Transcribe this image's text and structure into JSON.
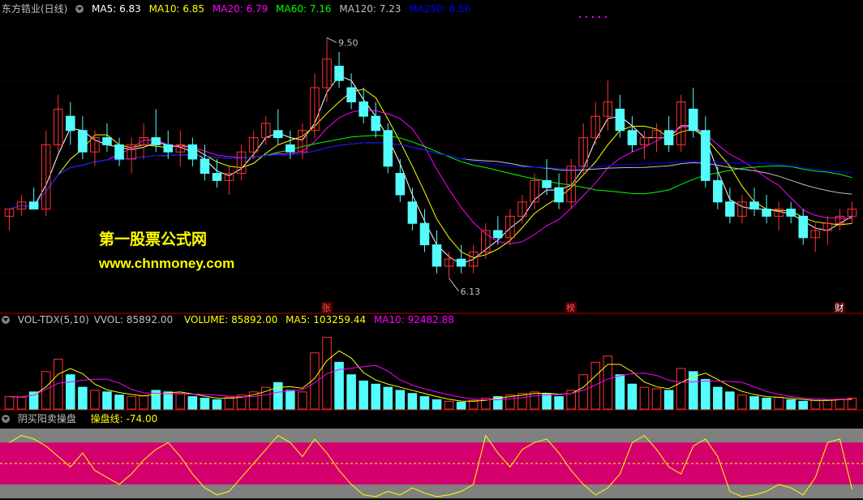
{
  "main_header": {
    "title": "东方锆业(日线)",
    "ma": [
      {
        "label": "MA5: 6.83",
        "color": "#ffffff"
      },
      {
        "label": "MA10: 6.85",
        "color": "#ffff00"
      },
      {
        "label": "MA20: 6.79",
        "color": "#ff00ff"
      },
      {
        "label": "MA60: 7.16",
        "color": "#00ff00"
      },
      {
        "label": "MA120: 7.23",
        "color": "#c0c0c0"
      },
      {
        "label": "MA250: 8.56",
        "color": "#0000ff"
      }
    ]
  },
  "annotations": {
    "high": "9.50",
    "low": "6.13"
  },
  "markers": [
    "张",
    "榜",
    "财"
  ],
  "watermark": {
    "line1": "第一股票公式网",
    "line2": "www.chnmoney.com"
  },
  "vol_header": {
    "name": "VOL-TDX(5,10)",
    "vvol": "VVOL: 85892.00",
    "volume": "VOLUME: 85892.00",
    "ma5": "MA5: 103259.44",
    "ma10": "MA10: 92482.88"
  },
  "ind_header": {
    "name": "阴买阳卖操盘",
    "line": "操盘线: -74.00"
  },
  "colors": {
    "up": "#ff3232",
    "down": "#54fcfc",
    "band": "#d4006e",
    "panel_gray": "#808080"
  },
  "chart_data": [
    {
      "type": "candlestick",
      "title": "东方锆业(日线)",
      "ohlc": [
        [
          7.0,
          7.1,
          6.8,
          7.1
        ],
        [
          7.1,
          7.3,
          7.0,
          7.2
        ],
        [
          7.2,
          7.4,
          7.1,
          7.1
        ],
        [
          7.1,
          8.2,
          7.0,
          8.0
        ],
        [
          8.0,
          8.7,
          7.9,
          8.5
        ],
        [
          8.4,
          8.6,
          8.0,
          8.2
        ],
        [
          8.2,
          8.4,
          7.8,
          7.9
        ],
        [
          7.9,
          8.2,
          7.7,
          8.1
        ],
        [
          8.1,
          8.3,
          7.9,
          8.0
        ],
        [
          8.0,
          8.1,
          7.7,
          7.8
        ],
        [
          7.8,
          8.1,
          7.6,
          8.0
        ],
        [
          8.0,
          8.3,
          7.8,
          8.1
        ],
        [
          8.1,
          8.5,
          7.9,
          8.0
        ],
        [
          8.0,
          8.2,
          7.8,
          7.9
        ],
        [
          7.9,
          8.2,
          7.7,
          8.0
        ],
        [
          8.0,
          8.1,
          7.7,
          7.8
        ],
        [
          7.8,
          8.0,
          7.5,
          7.6
        ],
        [
          7.6,
          7.8,
          7.4,
          7.5
        ],
        [
          7.5,
          7.7,
          7.3,
          7.6
        ],
        [
          7.6,
          8.0,
          7.5,
          7.9
        ],
        [
          7.9,
          8.2,
          7.8,
          8.1
        ],
        [
          8.1,
          8.4,
          8.0,
          8.3
        ],
        [
          8.2,
          8.5,
          8.0,
          8.1
        ],
        [
          8.0,
          8.2,
          7.8,
          7.9
        ],
        [
          7.9,
          8.3,
          7.8,
          8.2
        ],
        [
          8.2,
          9.0,
          8.1,
          8.8
        ],
        [
          8.8,
          9.5,
          8.6,
          9.2
        ],
        [
          9.1,
          9.3,
          8.8,
          8.9
        ],
        [
          8.8,
          9.0,
          8.5,
          8.6
        ],
        [
          8.6,
          8.8,
          8.3,
          8.4
        ],
        [
          8.4,
          8.6,
          8.1,
          8.2
        ],
        [
          8.2,
          8.3,
          7.6,
          7.7
        ],
        [
          7.6,
          7.8,
          7.2,
          7.3
        ],
        [
          7.2,
          7.4,
          6.8,
          6.9
        ],
        [
          6.9,
          7.1,
          6.5,
          6.6
        ],
        [
          6.6,
          6.8,
          6.2,
          6.3
        ],
        [
          6.3,
          6.5,
          6.13,
          6.4
        ],
        [
          6.4,
          6.6,
          6.2,
          6.3
        ],
        [
          6.3,
          6.6,
          6.2,
          6.5
        ],
        [
          6.5,
          6.9,
          6.4,
          6.8
        ],
        [
          6.8,
          7.0,
          6.6,
          6.7
        ],
        [
          6.7,
          7.1,
          6.6,
          7.0
        ],
        [
          7.0,
          7.3,
          6.9,
          7.2
        ],
        [
          7.2,
          7.6,
          7.1,
          7.5
        ],
        [
          7.5,
          7.8,
          7.3,
          7.4
        ],
        [
          7.4,
          7.6,
          7.1,
          7.2
        ],
        [
          7.2,
          7.8,
          7.1,
          7.7
        ],
        [
          7.7,
          8.3,
          7.6,
          8.1
        ],
        [
          8.1,
          8.6,
          8.0,
          8.4
        ],
        [
          8.4,
          8.9,
          8.2,
          8.6
        ],
        [
          8.5,
          8.7,
          8.1,
          8.2
        ],
        [
          8.2,
          8.4,
          7.9,
          8.0
        ],
        [
          8.0,
          8.2,
          7.8,
          8.1
        ],
        [
          8.1,
          8.3,
          7.9,
          8.2
        ],
        [
          8.2,
          8.4,
          7.9,
          8.0
        ],
        [
          8.0,
          8.7,
          7.9,
          8.6
        ],
        [
          8.5,
          8.8,
          8.1,
          8.2
        ],
        [
          8.2,
          8.4,
          7.4,
          7.5
        ],
        [
          7.5,
          7.7,
          7.1,
          7.2
        ],
        [
          7.2,
          7.4,
          6.9,
          7.0
        ],
        [
          7.0,
          7.3,
          6.9,
          7.2
        ],
        [
          7.2,
          7.4,
          7.0,
          7.1
        ],
        [
          7.1,
          7.3,
          6.9,
          7.0
        ],
        [
          7.0,
          7.2,
          6.8,
          7.1
        ],
        [
          7.1,
          7.2,
          6.9,
          7.0
        ],
        [
          7.0,
          7.1,
          6.6,
          6.7
        ],
        [
          6.7,
          6.9,
          6.5,
          6.8
        ],
        [
          6.8,
          7.0,
          6.6,
          6.9
        ],
        [
          6.9,
          7.1,
          6.8,
          7.0
        ],
        [
          7.0,
          7.2,
          6.9,
          7.1
        ]
      ],
      "ma_series": [
        {
          "name": "MA5",
          "color": "#ffffff"
        },
        {
          "name": "MA10",
          "color": "#ffff00"
        },
        {
          "name": "MA20",
          "color": "#ff00ff"
        },
        {
          "name": "MA60",
          "color": "#00ff00"
        },
        {
          "name": "MA120",
          "color": "#c0c0c0"
        },
        {
          "name": "MA250",
          "color": "#0000ff"
        }
      ],
      "ylim": [
        5.8,
        9.8
      ]
    },
    {
      "type": "bar",
      "title": "VOL-TDX(5,10)",
      "values": [
        40,
        38,
        55,
        120,
        160,
        110,
        70,
        60,
        55,
        45,
        40,
        42,
        60,
        55,
        50,
        40,
        35,
        30,
        38,
        45,
        55,
        70,
        85,
        60,
        55,
        180,
        230,
        150,
        110,
        90,
        80,
        70,
        60,
        50,
        40,
        30,
        25,
        22,
        28,
        35,
        40,
        45,
        50,
        55,
        48,
        40,
        60,
        110,
        150,
        170,
        110,
        80,
        70,
        65,
        60,
        130,
        120,
        95,
        70,
        55,
        45,
        40,
        35,
        38,
        30,
        25,
        28,
        30,
        32,
        35
      ],
      "ma_series": [
        {
          "name": "MA5",
          "color": "#ffff00"
        },
        {
          "name": "MA10",
          "color": "#ff00ff"
        }
      ],
      "ylim": [
        0,
        260
      ]
    },
    {
      "type": "line",
      "title": "阴买阳卖操盘",
      "series": [
        {
          "name": "操盘线",
          "values": [
            60,
            80,
            70,
            50,
            20,
            -10,
            30,
            -20,
            -40,
            -60,
            -30,
            10,
            40,
            60,
            20,
            -30,
            -70,
            -90,
            -80,
            -40,
            0,
            40,
            80,
            60,
            20,
            70,
            30,
            -20,
            -60,
            -90,
            -95,
            -80,
            -90,
            -70,
            -85,
            -95,
            -90,
            -80,
            -60,
            80,
            30,
            -10,
            40,
            60,
            70,
            30,
            -20,
            -60,
            -90,
            -70,
            -30,
            60,
            80,
            40,
            -10,
            -30,
            50,
            70,
            20,
            -80,
            -95,
            -90,
            -80,
            -60,
            -70,
            -90,
            -40,
            60,
            70,
            -74
          ]
        }
      ],
      "ylim": [
        -100,
        100
      ],
      "bands": {
        "upper": 60,
        "lower": -60
      }
    }
  ]
}
